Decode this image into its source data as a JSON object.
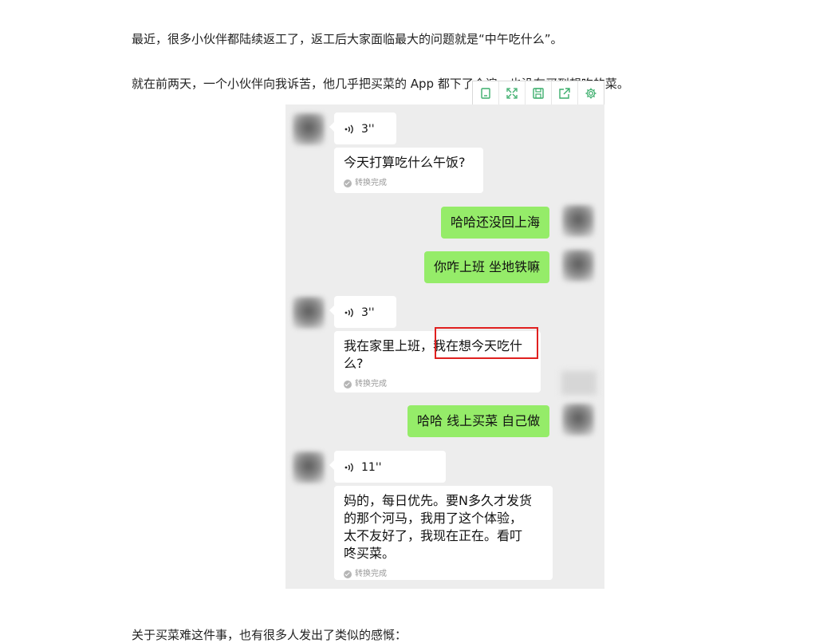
{
  "article": {
    "p1": "最近，很多小伙伴都陆续返工了，返工后大家面临最大的问题就是“中午吃什么”。",
    "p2": "就在前两天，一个小伙伴向我诉苦，他几乎把买菜的 App 都下了个遍，也没有买到想吃的菜。",
    "p3": "关于买菜难这件事，也有很多人发出了类似的感慨："
  },
  "toolbar": {
    "icons": [
      "copy-icon",
      "fullscreen-icon",
      "save-icon",
      "share-icon",
      "settings-gear-icon"
    ]
  },
  "chat": {
    "voice1": {
      "duration": "3''"
    },
    "trans1": {
      "text": "今天打算吃什么午饭?",
      "status": "转换完成"
    },
    "msg_out1": "哈哈还没回上海",
    "msg_out2": "你咋上班 坐地铁嘛",
    "voice2": {
      "duration": "3''"
    },
    "trans2": {
      "text": "我在家里上班，我在想今天吃什\n么?",
      "status": "转换完成"
    },
    "msg_out3": "哈哈 线上买菜 自己做",
    "voice3": {
      "duration": "11''"
    },
    "trans3": {
      "text": "妈的，每日优先。要N多久才发货\n的那个河马，我用了这个体验，\n太不友好了，我现在正在。看叮\n咚买菜。",
      "status": "转换完成"
    }
  },
  "colors": {
    "accent_green": "#95ec69",
    "highlight_red": "#e0201f",
    "toolbar_icon": "#3cae6c"
  }
}
